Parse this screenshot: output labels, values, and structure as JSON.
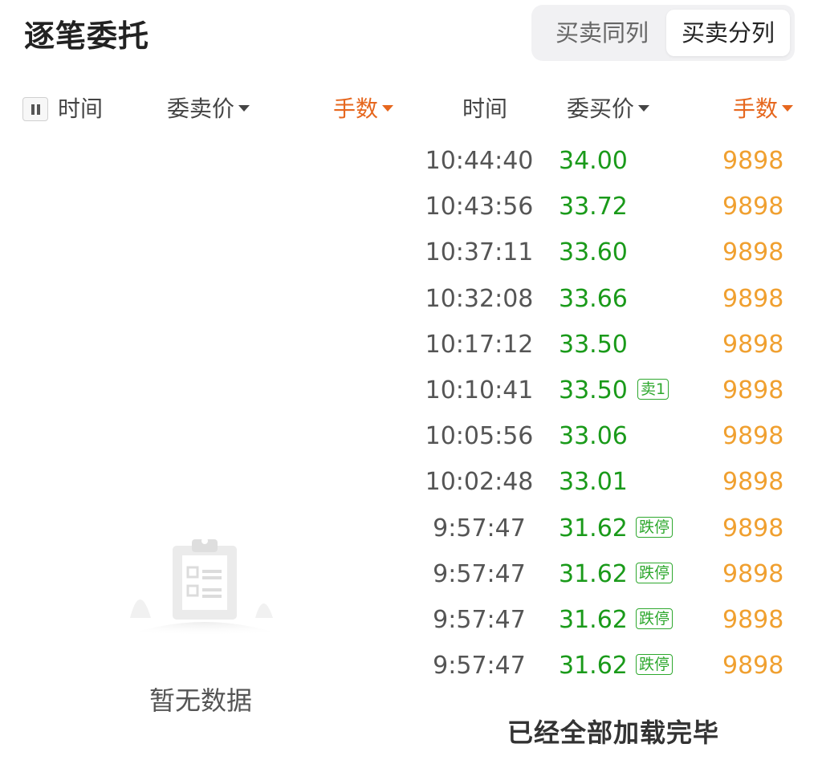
{
  "page": {
    "title": "逐笔委托"
  },
  "segment": {
    "same_col": "买卖同列",
    "split_col": "买卖分列"
  },
  "sell_header": {
    "time": "时间",
    "price": "委卖价",
    "volume": "手数"
  },
  "buy_header": {
    "time": "时间",
    "price": "委买价",
    "volume": "手数"
  },
  "sell_side": {
    "empty_text": "暂无数据"
  },
  "buy_side": {
    "rows": [
      {
        "time": "10:44:40",
        "price": "34.00",
        "badge": "",
        "volume": "9898"
      },
      {
        "time": "10:43:56",
        "price": "33.72",
        "badge": "",
        "volume": "9898"
      },
      {
        "time": "10:37:11",
        "price": "33.60",
        "badge": "",
        "volume": "9898"
      },
      {
        "time": "10:32:08",
        "price": "33.66",
        "badge": "",
        "volume": "9898"
      },
      {
        "time": "10:17:12",
        "price": "33.50",
        "badge": "",
        "volume": "9898"
      },
      {
        "time": "10:10:41",
        "price": "33.50",
        "badge": "卖1",
        "volume": "9898"
      },
      {
        "time": "10:05:56",
        "price": "33.06",
        "badge": "",
        "volume": "9898"
      },
      {
        "time": "10:02:48",
        "price": "33.01",
        "badge": "",
        "volume": "9898"
      },
      {
        "time": "9:57:47",
        "price": "31.62",
        "badge": "跌停",
        "volume": "9898"
      },
      {
        "time": "9:57:47",
        "price": "31.62",
        "badge": "跌停",
        "volume": "9898"
      },
      {
        "time": "9:57:47",
        "price": "31.62",
        "badge": "跌停",
        "volume": "9898"
      },
      {
        "time": "9:57:47",
        "price": "31.62",
        "badge": "跌停",
        "volume": "9898"
      }
    ],
    "footer_text": "已经全部加载完毕"
  },
  "colors": {
    "price_down": "#1a9a1a",
    "volume": "#f0a030",
    "sort_active": "#e6671e"
  }
}
